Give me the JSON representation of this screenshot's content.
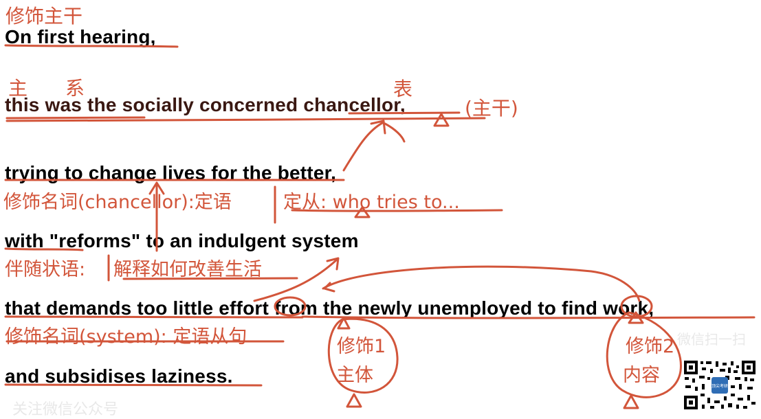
{
  "sentences": [
    "On first hearing,",
    "this was the socially concerned chancellor,",
    "trying to change lives for the better,",
    "with \"reforms\" to an indulgent system",
    "that demands too little effort from the newly unemployed to find work,",
    "and subsidises laziness."
  ],
  "notes": {
    "modifier_main": "修饰主干",
    "subject": "主",
    "linking": "系",
    "predicative": "表",
    "main_clause": "(主干)",
    "modifies_chancellor": "修饰名词(chancellor):定语",
    "attr_clause": "定从: who tries to...",
    "accompanying": "伴随状语:",
    "explain_how": "解释如何改善生活",
    "modifies_system": "修饰名词(system): 定语从句",
    "modifier1": "修饰1",
    "subject_body": "主体",
    "modifier2": "修饰2",
    "content": "内容"
  },
  "watermark": {
    "bottom": "关注微信公众号",
    "right": "微信扫一扫"
  },
  "qr_badge": "顶尖考研",
  "colors": {
    "ink": "#d2553a",
    "text": "#000000"
  }
}
